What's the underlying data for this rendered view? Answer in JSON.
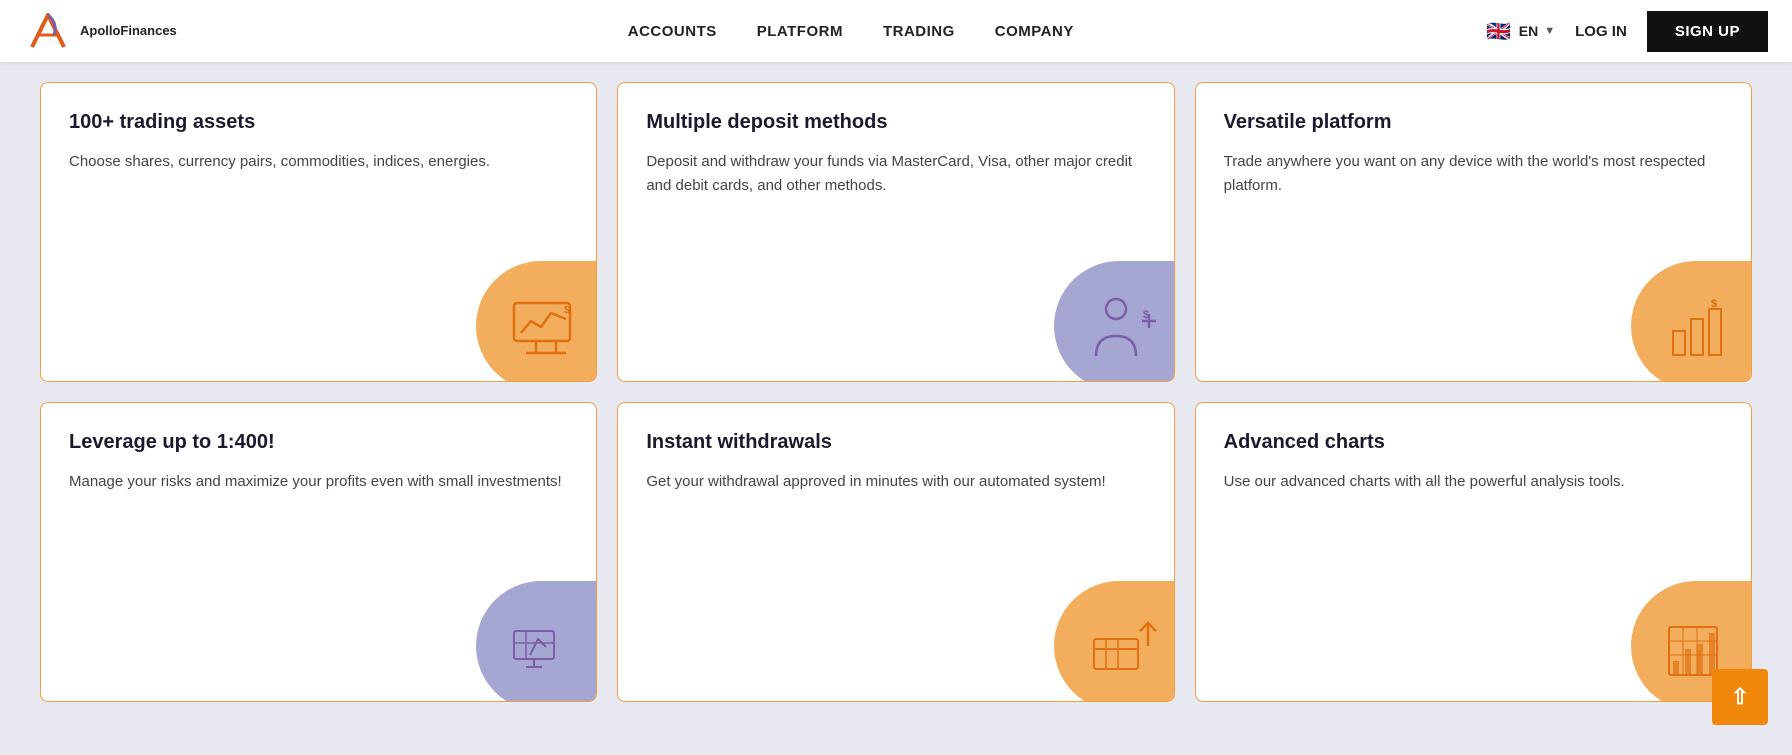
{
  "navbar": {
    "logo_text": "ApolloFinances",
    "links": [
      {
        "label": "ACCOUNTS",
        "id": "accounts"
      },
      {
        "label": "PLATFORM",
        "id": "platform"
      },
      {
        "label": "TRADING",
        "id": "trading"
      },
      {
        "label": "COMPANY",
        "id": "company"
      }
    ],
    "lang_code": "EN",
    "login_label": "LOG IN",
    "signup_label": "SIGN UP"
  },
  "cards": {
    "row1": [
      {
        "id": "card-trading-assets",
        "title": "100+ trading assets",
        "desc": "Choose shares, currency pairs, commodities, indices, energies.",
        "blob": "orange",
        "icon": "chart-monitor"
      },
      {
        "id": "card-deposit-methods",
        "title": "Multiple deposit methods",
        "desc": "Deposit and withdraw your funds via MasterCard, Visa, other major credit and debit cards, and other methods.",
        "blob": "purple",
        "icon": "businessman-money"
      },
      {
        "id": "card-versatile-platform",
        "title": "Versatile platform",
        "desc": "Trade anywhere you want on any device with the world's most respected platform.",
        "blob": "orange",
        "icon": "bar-chart-dollar"
      }
    ],
    "row2": [
      {
        "id": "card-leverage",
        "title": "Leverage up to 1:400!",
        "desc": "Manage your risks and maximize your profits even with small investments!",
        "blob": "purple",
        "icon": "leverage-chart"
      },
      {
        "id": "card-withdrawals",
        "title": "Instant withdrawals",
        "desc": "Get your withdrawal approved in minutes with our automated system!",
        "blob": "orange",
        "icon": "withdrawal-icon"
      },
      {
        "id": "card-advanced-charts",
        "title": "Advanced charts",
        "desc": "Use our advanced charts with all the powerful analysis tools.",
        "blob": "orange",
        "icon": "advanced-chart-icon"
      }
    ]
  },
  "back_to_top_label": "^"
}
